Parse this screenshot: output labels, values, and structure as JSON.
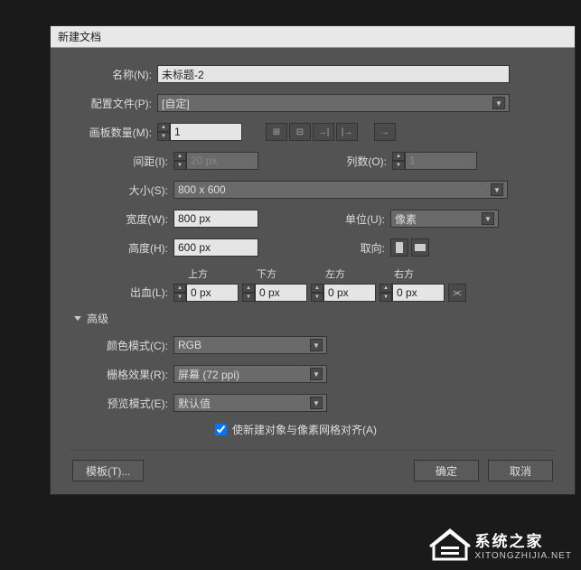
{
  "dialog": {
    "title": "新建文档",
    "name_label": "名称(N):",
    "name_value": "未标题-2",
    "profile_label": "配置文件(P):",
    "profile_value": "[自定]",
    "artboard_label": "画板数量(M):",
    "artboard_value": "1",
    "spacing_label": "间距(I):",
    "spacing_value": "20 px",
    "cols_label": "列数(O):",
    "cols_value": "1",
    "size_label": "大小(S):",
    "size_value": "800 x 600",
    "width_label": "宽度(W):",
    "width_value": "800 px",
    "unit_label": "单位(U):",
    "unit_value": "像素",
    "height_label": "高度(H):",
    "height_value": "600 px",
    "orient_label": "取向:",
    "bleed_label": "出血(L):",
    "bleed_top": "上方",
    "bleed_bottom": "下方",
    "bleed_left": "左方",
    "bleed_right": "右方",
    "bleed_value": "0 px",
    "advanced": "高级",
    "colormode_label": "颜色模式(C):",
    "colormode_value": "RGB",
    "raster_label": "栅格效果(R):",
    "raster_value": "屏幕 (72 ppi)",
    "preview_label": "预览模式(E):",
    "preview_value": "默认值",
    "align_label": "使新建对象与像素网格对齐(A)",
    "template_btn": "模板(T)...",
    "ok_btn": "确定",
    "cancel_btn": "取消"
  },
  "watermark": {
    "line1": "系统之家",
    "line2": "XITONGZHIJIA.NET"
  }
}
